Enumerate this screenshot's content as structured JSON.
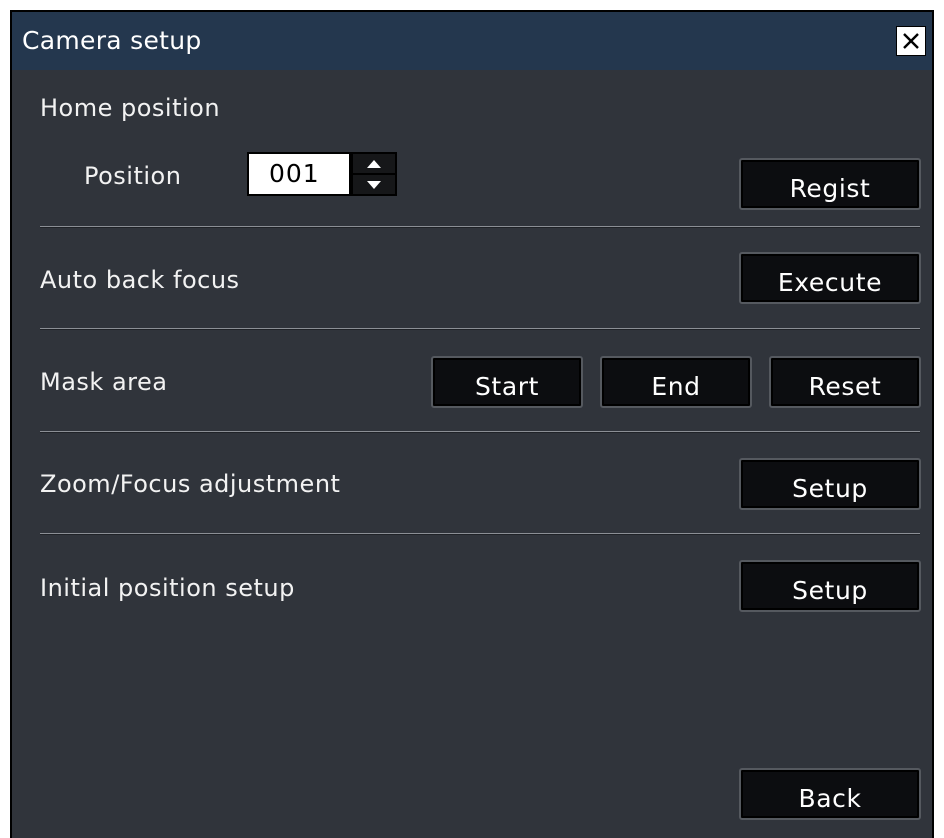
{
  "window": {
    "title": "Camera setup",
    "close_icon": "close-icon"
  },
  "home_position": {
    "label": "Home position",
    "position_label": "Position",
    "position_value": "001",
    "regist_label": "Regist"
  },
  "auto_back_focus": {
    "label": "Auto back focus",
    "execute_label": "Execute"
  },
  "mask_area": {
    "label": "Mask area",
    "start_label": "Start",
    "end_label": "End",
    "reset_label": "Reset"
  },
  "zoom_focus": {
    "label": "Zoom/Focus adjustment",
    "setup_label": "Setup"
  },
  "initial_position": {
    "label": "Initial position setup",
    "setup_label": "Setup"
  },
  "footer": {
    "back_label": "Back"
  },
  "colors": {
    "title_bar": "#24374e",
    "panel_bg": "#30343b",
    "button_bg": "#0c0d10",
    "text": "#f2f2f2"
  }
}
